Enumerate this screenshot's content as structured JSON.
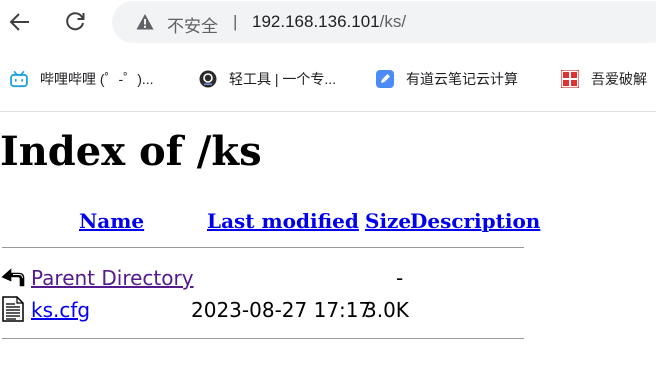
{
  "browser": {
    "security_label": "不安全",
    "separator": "|",
    "url_host": "192.168.136.101",
    "url_path": "/ks/"
  },
  "bookmarks": [
    {
      "label": "哔哩哔哩 (゜-゜)...",
      "icon": "bilibili-icon"
    },
    {
      "label": "轻工具 | 一个专...",
      "icon": "qinggongju-icon"
    },
    {
      "label": "有道云笔记云计算",
      "icon": "youdao-note-icon"
    },
    {
      "label": "吾爱破解",
      "icon": "52pojie-icon"
    }
  ],
  "page": {
    "title": "Index of /ks",
    "columns": {
      "name": "Name",
      "last_modified": "Last modified",
      "size": "Size",
      "description": "Description"
    },
    "rows": [
      {
        "name": "Parent Directory",
        "modified": "",
        "size": "-",
        "icon": "back-arrow-icon",
        "link_color": "#551a8b"
      },
      {
        "name": "ks.cfg",
        "modified": "2023-08-27 17:17",
        "size": "3.0K",
        "icon": "text-file-icon",
        "link_color": "#0000ee"
      }
    ]
  },
  "colors": {
    "link": "#0000ee",
    "visited_link": "#551a8b",
    "omnibox_bg": "#f1f3f4"
  }
}
